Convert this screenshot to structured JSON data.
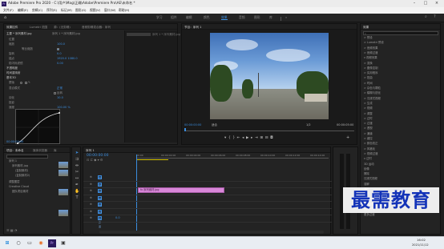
{
  "window": {
    "title": "Adobe Premiere Pro 2020 - C:\\用户\\Mag\\正确\\Adobe\\Premiere Pro\\AE\\未命名 *",
    "controls": [
      "minimize",
      "maximize",
      "close"
    ]
  },
  "menubar": [
    "文件(F)",
    "编辑(E)",
    "剪辑(C)",
    "序列(S)",
    "标记(M)",
    "图形(G)",
    "视图(V)",
    "窗口(W)",
    "帮助(H)"
  ],
  "workspaces": [
    "学习",
    "组件",
    "编辑",
    "颜色",
    "效果",
    "音频",
    "图形",
    "库"
  ],
  "active_workspace": "效果",
  "effect_controls": {
    "tabs": [
      "效果控件",
      "Lumetri 范围",
      "源：(无剪辑)",
      "音频剪辑混合器：序列"
    ],
    "source_label": "主要 * 序列素材.jpg",
    "sequence_label": "序列 1 * 序列素材.jpg",
    "rows": [
      {
        "name": "位置",
        "value": ""
      },
      {
        "name": "缩放",
        "value": "100.0"
      },
      {
        "name": "等比缩放",
        "value": "✓"
      },
      {
        "name": "旋转",
        "value": "0.0"
      },
      {
        "name": "锚点",
        "value": "1920.0  1080.0"
      },
      {
        "name": "防闪烁滤镜",
        "value": "0.00"
      },
      {
        "name": "不透明度",
        "value": ""
      },
      {
        "name": "时间重映射",
        "value": ""
      },
      {
        "name": "基本3D",
        "value": ""
      },
      {
        "name": "蒙版",
        "value": ""
      },
      {
        "name": "混合模式",
        "value": "正常"
      },
      {
        "name": "反转",
        "value": ""
      },
      {
        "name": "羽化",
        "value": "10.0"
      },
      {
        "name": "投影",
        "value": ""
      },
      {
        "name": "速度",
        "value": "100.00 %"
      }
    ],
    "graph_label": "速度曲线",
    "timecode": "00:00:00:00"
  },
  "program_monitor": {
    "tab": "节目：序列 1",
    "timecode_left": "00:00:00:00",
    "fit": "适合",
    "quality": "1/2",
    "timecode_right": "00:00:05:00",
    "buttons": [
      "marker",
      "in",
      "out",
      "go-to-in",
      "step-back",
      "play",
      "step-forward",
      "go-to-out",
      "insert",
      "overwrite",
      "export-frame",
      "settings"
    ]
  },
  "effects": {
    "tab": "效果",
    "search_placeholder": "",
    "tree": [
      "> 预设",
      "> Lumetri 预设",
      "> 音频效果",
      "> 音频过渡",
      "v 视频效果",
      "    > 变换",
      "    > 图像控制",
      "    > 实用程序",
      "    > 扭曲",
      "    > 时间",
      "    > 杂色与颗粒",
      "    > 模糊与锐化",
      "    > 沉浸式视频",
      "    > 生成",
      "    > 视频",
      "    > 调整",
      "    > 过时",
      "    > 过渡",
      "    > 透视",
      "    > 通道",
      "    > 键控",
      "    > 颜色校正",
      "    > 风格化",
      "> 视频过渡",
      "v 过时",
      "    3D 运动",
      "    划像",
      "    擦除",
      "    沉浸式视频",
      "    溶解",
      "    滑动",
      "    缩放",
      "    页面剥落",
      "    交叉缩放",
      "    视频过渡",
      "    更多过渡"
    ]
  },
  "project": {
    "tabs": [
      "项目：未命名",
      "媒体浏览器",
      "库",
      "信息"
    ],
    "items": [
      {
        "name": "序列 1",
        "type": "sequence"
      },
      {
        "name": "序列素材.jpg",
        "type": "image"
      },
      {
        "name": "(复制素材)",
        "type": "image"
      },
      {
        "name": "(复制素材2)",
        "type": "image"
      },
      {
        "name": "调整图层",
        "type": "adjustment"
      },
      {
        "name": "Creative Cloud",
        "type": "folder"
      },
      {
        "name": "团队项目素材",
        "type": "folder"
      }
    ]
  },
  "timeline": {
    "tab": "序列 1",
    "timecode": "00:00:00:00",
    "ruler": [
      "00:00",
      "00:00:02:00",
      "00:00:04:00",
      "00:00:06:00",
      "00:00:08:00",
      "00:00:10:00",
      "00:00:12:00",
      "00:00:14:00"
    ],
    "tracks": [
      "V3",
      "V2",
      "V1",
      "A1",
      "A2",
      "A3",
      "主声道"
    ],
    "master_value": "0.0",
    "clip_label": "fx 序列素材.jpg"
  },
  "watermark": "最需教育",
  "taskbar": {
    "time": "16:02",
    "date": "2021/11/12"
  },
  "colors": {
    "accent": "#3b8dde",
    "clip": "#d987d9",
    "panel_bg": "#232323"
  }
}
